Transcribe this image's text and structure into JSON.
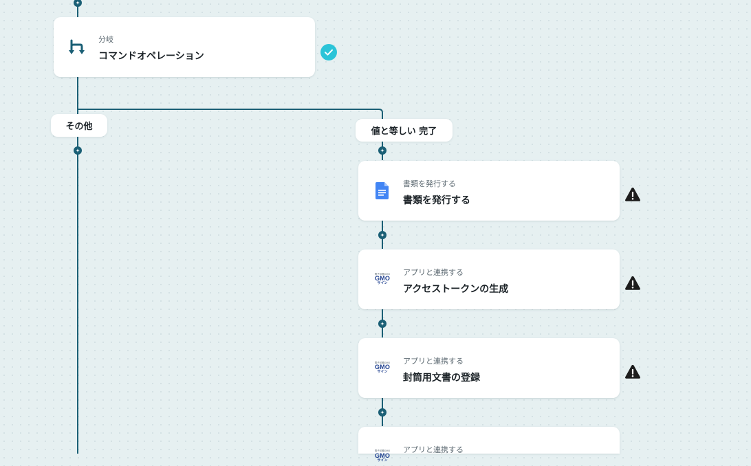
{
  "colors": {
    "canvas_bg": "#e6f0f1",
    "edge": "#1a5f75",
    "check": "#2bc4d8",
    "warning": "#1c1c1c",
    "docs_blue": "#4285f4",
    "gmo_blue": "#1d3e8e"
  },
  "branch_node": {
    "icon": "branch-icon",
    "sub": "分岐",
    "title": "コマンドオペレーション",
    "status": "check-circle-icon"
  },
  "branches": {
    "other": "その他",
    "equal": "値と等しい 完了"
  },
  "steps": [
    {
      "icon": "google-docs-icon",
      "sub": "書類を発行する",
      "title": "書類を発行する",
      "status": "warning-icon"
    },
    {
      "icon": "gmo-sign-icon",
      "sub": "アプリと連携する",
      "title": "アクセストークンの生成",
      "status": "warning-icon",
      "logo_text": "GMO",
      "logo_kana": "サイン"
    },
    {
      "icon": "gmo-sign-icon",
      "sub": "アプリと連携する",
      "title": "封筒用文書の登録",
      "status": "warning-icon",
      "logo_text": "GMO",
      "logo_kana": "サイン"
    },
    {
      "icon": "gmo-sign-icon",
      "sub": "アプリと連携する",
      "title": "",
      "status": "warning-icon",
      "logo_text": "GMO",
      "logo_kana": "サイン"
    }
  ]
}
